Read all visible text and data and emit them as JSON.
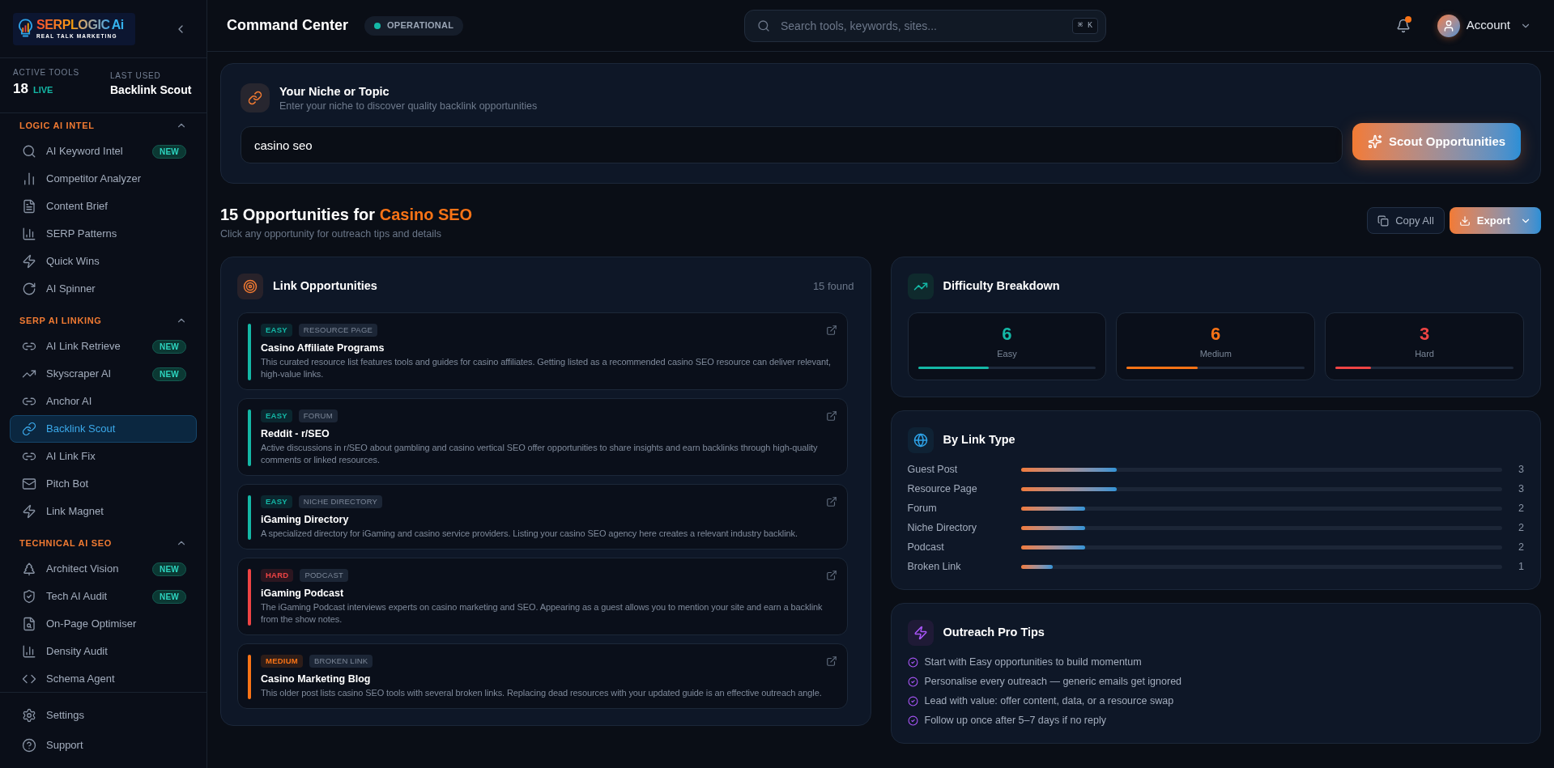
{
  "sidebar": {
    "logo": {
      "wordmark": "SERPLOGIC",
      "accent": "Ai",
      "tagline": "REAL TALK MARKETING"
    },
    "stats": [
      {
        "label": "ACTIVE TOOLS",
        "value": "18",
        "badge": "LIVE"
      },
      {
        "label": "LAST USED",
        "value": "Backlink Scout"
      }
    ],
    "sections": [
      {
        "title": "LOGIC AI INTEL",
        "expanded": true,
        "items": [
          {
            "label": "AI Keyword Intel",
            "badge": "NEW",
            "selected": false
          },
          {
            "label": "Competitor Analyzer",
            "selected": false
          },
          {
            "label": "Content Brief",
            "selected": false
          },
          {
            "label": "SERP Patterns",
            "selected": false
          },
          {
            "label": "Quick Wins",
            "selected": false
          },
          {
            "label": "AI Spinner",
            "selected": false
          }
        ]
      },
      {
        "title": "SERP AI LINKING",
        "expanded": true,
        "items": [
          {
            "label": "AI Link Retrieve",
            "badge": "NEW",
            "selected": false
          },
          {
            "label": "Skyscraper AI",
            "badge": "NEW",
            "selected": false
          },
          {
            "label": "Anchor AI",
            "selected": false
          },
          {
            "label": "Backlink Scout",
            "selected": true
          },
          {
            "label": "AI Link Fix",
            "selected": false
          },
          {
            "label": "Pitch Bot",
            "selected": false
          },
          {
            "label": "Link Magnet",
            "selected": false
          }
        ]
      },
      {
        "title": "TECHNICAL AI SEO",
        "expanded": true,
        "items": [
          {
            "label": "Architect Vision",
            "badge": "NEW",
            "selected": false
          },
          {
            "label": "Tech AI Audit",
            "badge": "NEW",
            "selected": false
          },
          {
            "label": "On-Page Optimiser",
            "selected": false
          },
          {
            "label": "Density Audit",
            "selected": false
          },
          {
            "label": "Schema Agent",
            "selected": false
          }
        ]
      }
    ],
    "footer_items": [
      {
        "label": "Settings",
        "selected": false
      },
      {
        "label": "Support",
        "selected": false
      }
    ]
  },
  "topbar": {
    "title": "Command Center",
    "status": {
      "label": "OPERATIONAL"
    },
    "search": {
      "placeholder": "Search tools, keywords, sites...",
      "shortcut": "⌘ K"
    },
    "notifications": {
      "unread": true
    },
    "account": {
      "label": "Account"
    }
  },
  "niche": {
    "title": "Your Niche or Topic",
    "subtitle": "Enter your niche to discover quality backlink opportunities",
    "input": {
      "value": "casino seo"
    },
    "button": "Scout Opportunities"
  },
  "results": {
    "title": "15 Opportunities for",
    "highlight": "Casino SEO",
    "subtitle": "Click any opportunity for outreach tips and details",
    "buttons": [
      {
        "label": "Copy All",
        "kind": "secondary"
      },
      {
        "label": "Export",
        "kind": "primary"
      }
    ]
  },
  "link_opportunities": {
    "title": "Link Opportunities",
    "count": "15 found",
    "items": [
      {
        "difficulty": "EASY",
        "type": "RESOURCE PAGE",
        "title": "Casino Affiliate Programs",
        "description": "This curated resource list features tools and guides for casino affiliates. Getting listed as a recommended casino SEO resource can deliver relevant, high-value links.",
        "color": "#14b8a6"
      },
      {
        "difficulty": "EASY",
        "type": "FORUM",
        "title": "Reddit - r/SEO",
        "description": "Active discussions in r/SEO about gambling and casino vertical SEO offer opportunities to share insights and earn backlinks through high-quality comments or linked resources.",
        "color": "#14b8a6"
      },
      {
        "difficulty": "EASY",
        "type": "NICHE DIRECTORY",
        "title": "iGaming Directory",
        "description": "A specialized directory for iGaming and casino service providers. Listing your casino SEO agency here creates a relevant industry backlink.",
        "color": "#14b8a6"
      },
      {
        "difficulty": "HARD",
        "type": "PODCAST",
        "title": "iGaming Podcast",
        "description": "The iGaming Podcast interviews experts on casino marketing and SEO. Appearing as a guest allows you to mention your site and earn a backlink from the show notes.",
        "color": "#ef4444"
      },
      {
        "difficulty": "MEDIUM",
        "type": "BROKEN LINK",
        "title": "Casino Marketing Blog",
        "description": "This older post lists casino SEO tools with several broken links. Replacing dead resources with your updated guide is an effective outreach angle.",
        "color": "#f97316"
      }
    ]
  },
  "difficulty_breakdown": {
    "title": "Difficulty Breakdown",
    "items": [
      {
        "value": "6",
        "label": "Easy",
        "level": 0.4,
        "color": "#14b8a6"
      },
      {
        "value": "6",
        "label": "Medium",
        "level": 0.4,
        "color": "#f97316"
      },
      {
        "value": "3",
        "label": "Hard",
        "level": 0.2,
        "color": "#ef4444"
      }
    ]
  },
  "by_link_type": {
    "title": "By Link Type",
    "rows": [
      {
        "label": "Guest Post",
        "level": 0.2,
        "count": "3"
      },
      {
        "label": "Resource Page",
        "level": 0.2,
        "count": "3"
      },
      {
        "label": "Forum",
        "level": 0.1333,
        "count": "2"
      },
      {
        "label": "Niche Directory",
        "level": 0.1333,
        "count": "2"
      },
      {
        "label": "Podcast",
        "level": 0.1333,
        "count": "2"
      },
      {
        "label": "Broken Link",
        "level": 0.0667,
        "count": "1"
      }
    ]
  },
  "outreach_tips": {
    "title": "Outreach Pro Tips",
    "tips": [
      "Start with Easy opportunities to build momentum",
      "Personalise every outreach — generic emails get ignored",
      "Lead with value: offer content, data, or a resource swap",
      "Follow up once after 5–7 days if no reply"
    ]
  }
}
